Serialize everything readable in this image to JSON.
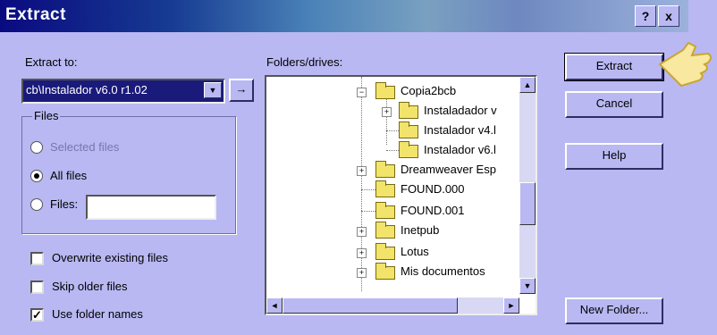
{
  "window": {
    "title": "Extract",
    "help_button": "?",
    "close_button": "x"
  },
  "extract_to": {
    "label": "Extract to:",
    "value": "cb\\Instalador v6.0 r1.02",
    "browse_button": "→"
  },
  "files_group": {
    "title": "Files",
    "options": [
      {
        "label": "Selected files",
        "selected": false
      },
      {
        "label": "All files",
        "selected": true
      },
      {
        "label": "Files:",
        "selected": false
      }
    ],
    "files_value": ""
  },
  "checkboxes": [
    {
      "label": "Overwrite existing files",
      "checked": false
    },
    {
      "label": "Skip older files",
      "checked": false
    },
    {
      "label": "Use folder names",
      "checked": true
    }
  ],
  "folders": {
    "label": "Folders/drives:",
    "items": [
      {
        "label": "Copia2bcb",
        "expander": "−"
      },
      {
        "label": "Instaladador v",
        "expander": "+"
      },
      {
        "label": "Instalador v4.l",
        "expander": ""
      },
      {
        "label": "Instalador v6.l",
        "expander": ""
      },
      {
        "label": "Dreamweaver Esp",
        "expander": "+"
      },
      {
        "label": "FOUND.000",
        "expander": ""
      },
      {
        "label": "FOUND.001",
        "expander": ""
      },
      {
        "label": "Inetpub",
        "expander": "+"
      },
      {
        "label": "Lotus",
        "expander": "+"
      },
      {
        "label": "Mis documentos",
        "expander": "+"
      }
    ]
  },
  "buttons": {
    "extract": "Extract",
    "cancel": "Cancel",
    "help": "Help",
    "new_folder": "New Folder..."
  }
}
